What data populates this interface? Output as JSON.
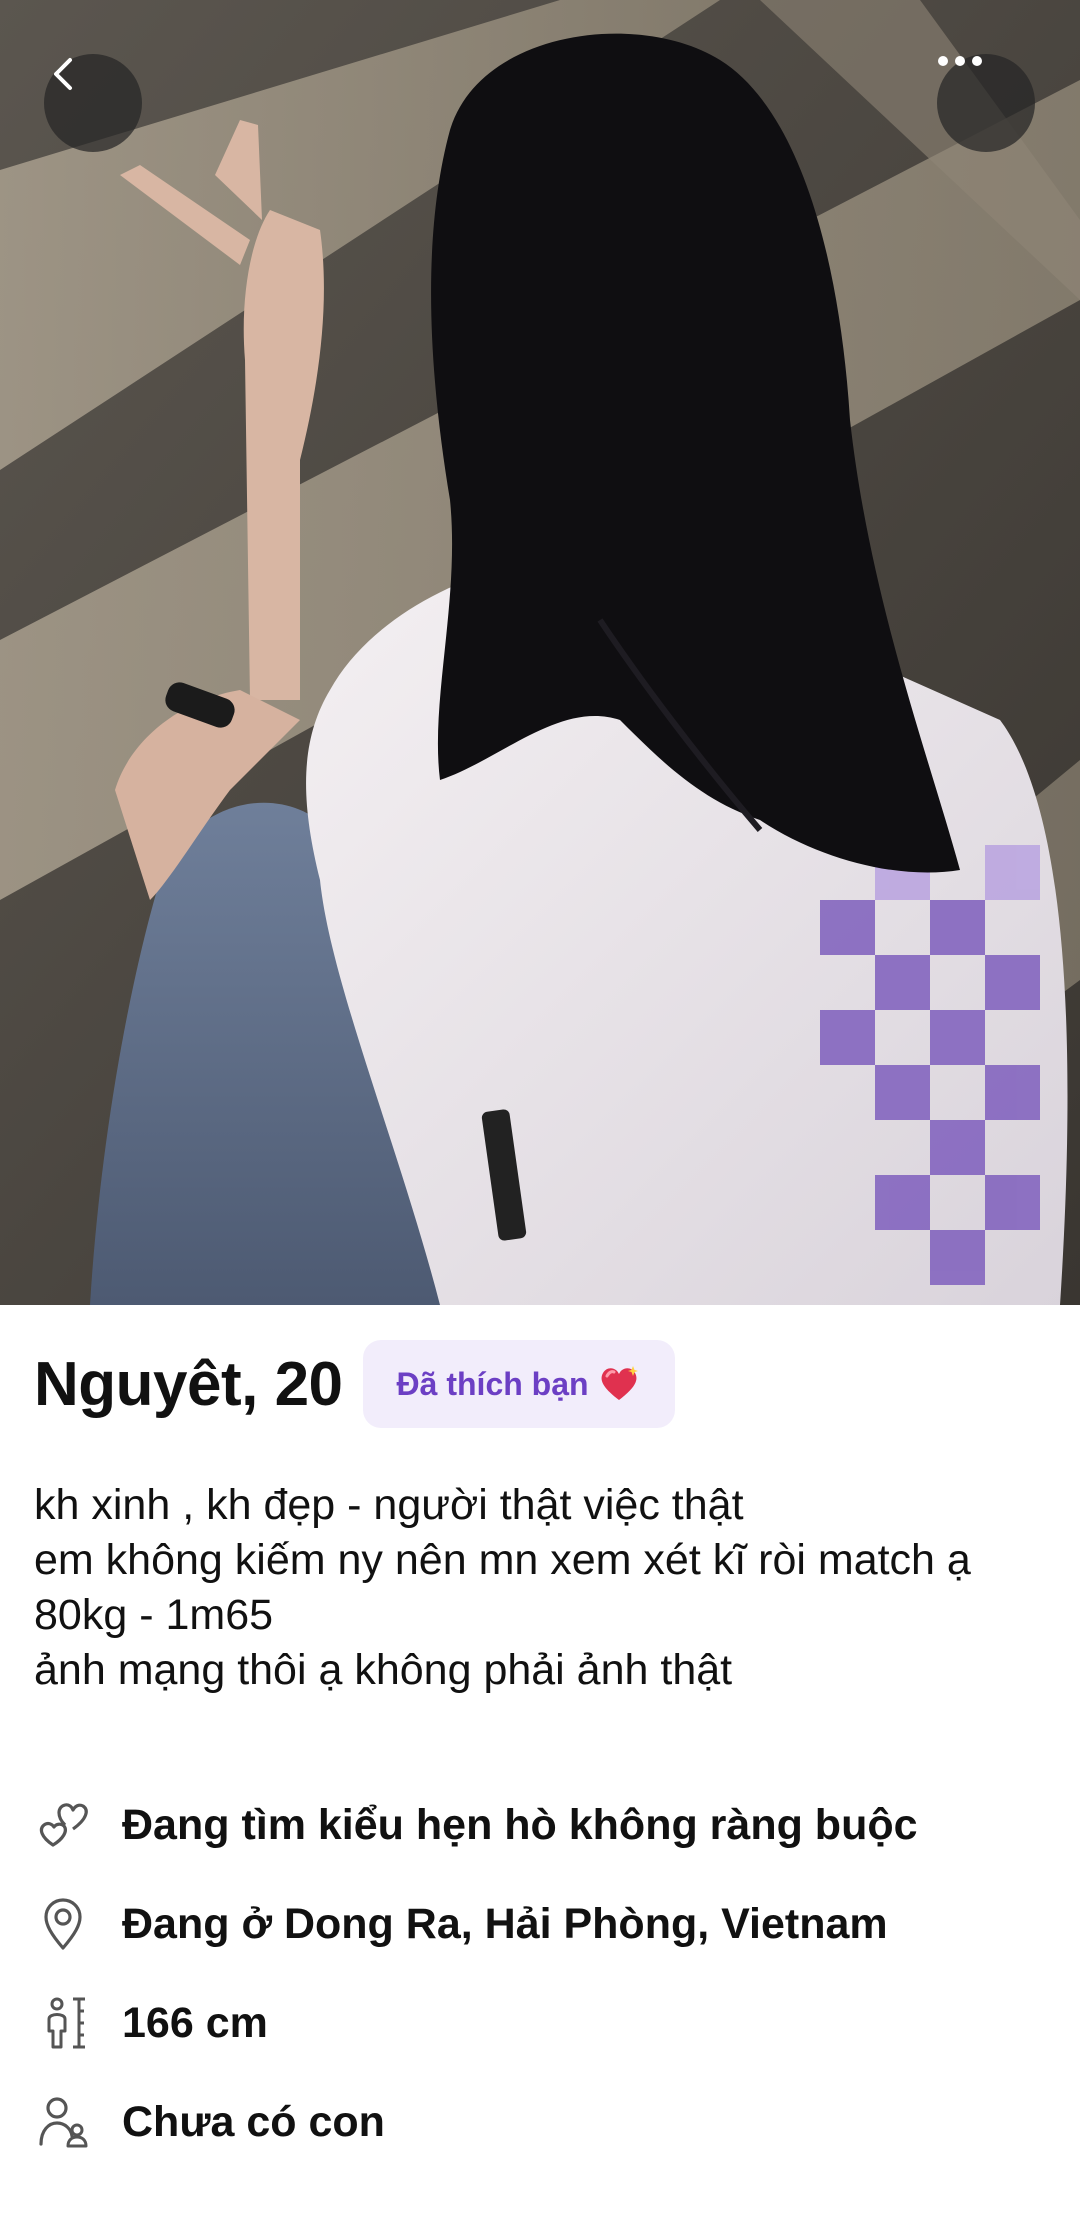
{
  "profile": {
    "name_age": "Nguyêt, 20",
    "liked_badge": "Đã thích bạn",
    "liked_badge_icon": "sparkling-heart-icon",
    "bio": "kh xinh , kh đẹp - người thật việc thật\nem không kiếm ny nên mn xem xét kĩ ròi match ạ\n80kg - 1m65\nảnh mạng thôi ạ không phải ảnh thật"
  },
  "details": [
    {
      "icon": "hearts-icon",
      "text": "Đang tìm kiểu hẹn hò không ràng buộc"
    },
    {
      "icon": "location-pin-icon",
      "text": "Đang ở Dong Ra, Hải Phòng, Vietnam"
    },
    {
      "icon": "height-icon",
      "text": "166 cm"
    },
    {
      "icon": "children-icon",
      "text": "Chưa có con"
    }
  ],
  "topbar": {
    "back_icon": "chevron-left-icon",
    "more_icon": "more-dots-icon"
  },
  "colors": {
    "badge_bg": "#f2edfb",
    "badge_text": "#6c3fc4",
    "text": "#111111",
    "button_bg": "#262626"
  }
}
